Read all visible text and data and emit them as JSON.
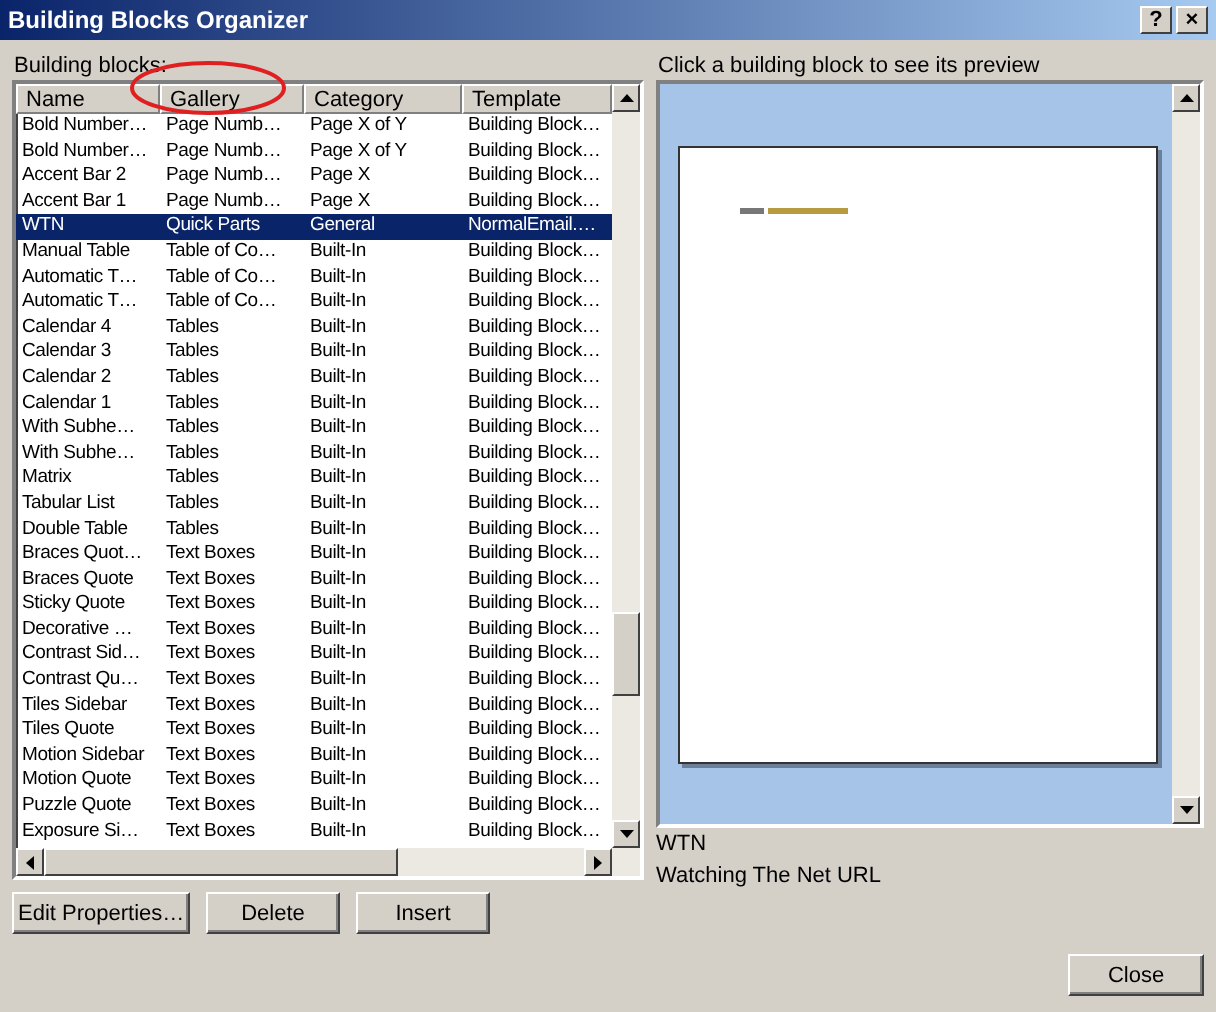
{
  "window": {
    "title": "Building Blocks Organizer",
    "help_button": "?",
    "close_button": "×"
  },
  "list_label": "Building blocks:",
  "table": {
    "columns": [
      "Name",
      "Gallery",
      "Category",
      "Template"
    ],
    "rows": [
      {
        "cells": [
          "Bold Number…",
          "Page Numb…",
          "Page X of Y",
          "Building Block…"
        ],
        "selected": false
      },
      {
        "cells": [
          "Bold Number…",
          "Page Numb…",
          "Page X of Y",
          "Building Block…"
        ],
        "selected": false
      },
      {
        "cells": [
          "Accent Bar 2",
          "Page Numb…",
          "Page X",
          "Building Block…"
        ],
        "selected": false
      },
      {
        "cells": [
          "Accent Bar 1",
          "Page Numb…",
          "Page X",
          "Building Block…"
        ],
        "selected": false
      },
      {
        "cells": [
          "WTN",
          "Quick Parts",
          "General",
          "NormalEmail.…"
        ],
        "selected": true
      },
      {
        "cells": [
          "Manual Table",
          "Table of Co…",
          "Built-In",
          "Building Block…"
        ],
        "selected": false
      },
      {
        "cells": [
          "Automatic T…",
          "Table of Co…",
          "Built-In",
          "Building Block…"
        ],
        "selected": false
      },
      {
        "cells": [
          "Automatic T…",
          "Table of Co…",
          "Built-In",
          "Building Block…"
        ],
        "selected": false
      },
      {
        "cells": [
          "Calendar 4",
          "Tables",
          "Built-In",
          "Building Block…"
        ],
        "selected": false
      },
      {
        "cells": [
          "Calendar 3",
          "Tables",
          "Built-In",
          "Building Block…"
        ],
        "selected": false
      },
      {
        "cells": [
          "Calendar 2",
          "Tables",
          "Built-In",
          "Building Block…"
        ],
        "selected": false
      },
      {
        "cells": [
          "Calendar 1",
          "Tables",
          "Built-In",
          "Building Block…"
        ],
        "selected": false
      },
      {
        "cells": [
          "With Subhe…",
          "Tables",
          "Built-In",
          "Building Block…"
        ],
        "selected": false
      },
      {
        "cells": [
          "With Subhe…",
          "Tables",
          "Built-In",
          "Building Block…"
        ],
        "selected": false
      },
      {
        "cells": [
          "Matrix",
          "Tables",
          "Built-In",
          "Building Block…"
        ],
        "selected": false
      },
      {
        "cells": [
          "Tabular List",
          "Tables",
          "Built-In",
          "Building Block…"
        ],
        "selected": false
      },
      {
        "cells": [
          "Double Table",
          "Tables",
          "Built-In",
          "Building Block…"
        ],
        "selected": false
      },
      {
        "cells": [
          "Braces Quot…",
          "Text Boxes",
          "Built-In",
          "Building Block…"
        ],
        "selected": false
      },
      {
        "cells": [
          "Braces Quote",
          "Text Boxes",
          "Built-In",
          "Building Block…"
        ],
        "selected": false
      },
      {
        "cells": [
          "Sticky Quote",
          "Text Boxes",
          "Built-In",
          "Building Block…"
        ],
        "selected": false
      },
      {
        "cells": [
          "Decorative …",
          "Text Boxes",
          "Built-In",
          "Building Block…"
        ],
        "selected": false
      },
      {
        "cells": [
          "Contrast Sid…",
          "Text Boxes",
          "Built-In",
          "Building Block…"
        ],
        "selected": false
      },
      {
        "cells": [
          "Contrast Qu…",
          "Text Boxes",
          "Built-In",
          "Building Block…"
        ],
        "selected": false
      },
      {
        "cells": [
          "Tiles Sidebar",
          "Text Boxes",
          "Built-In",
          "Building Block…"
        ],
        "selected": false
      },
      {
        "cells": [
          "Tiles Quote",
          "Text Boxes",
          "Built-In",
          "Building Block…"
        ],
        "selected": false
      },
      {
        "cells": [
          "Motion Sidebar",
          "Text Boxes",
          "Built-In",
          "Building Block…"
        ],
        "selected": false
      },
      {
        "cells": [
          "Motion Quote",
          "Text Boxes",
          "Built-In",
          "Building Block…"
        ],
        "selected": false
      },
      {
        "cells": [
          "Puzzle Quote",
          "Text Boxes",
          "Built-In",
          "Building Block…"
        ],
        "selected": false
      },
      {
        "cells": [
          "Exposure Si…",
          "Text Boxes",
          "Built-In",
          "Building Block…"
        ],
        "selected": false
      }
    ]
  },
  "preview": {
    "hint": "Click a building block to see its preview",
    "name": "WTN",
    "description": "Watching The Net URL"
  },
  "buttons": [
    "Edit Properties…",
    "Delete",
    "Insert"
  ],
  "close": "Close"
}
